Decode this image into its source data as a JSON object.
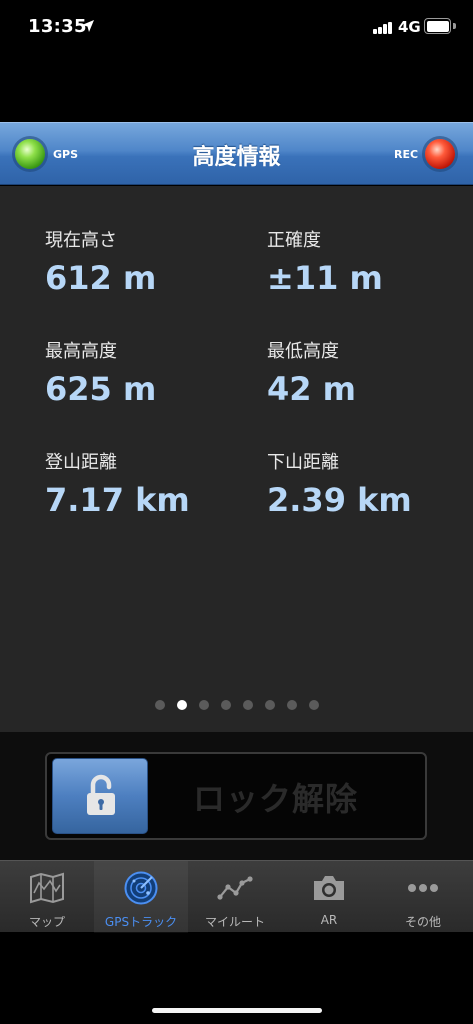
{
  "status_bar": {
    "time": "13:35",
    "network": "4G",
    "icons": [
      "location-arrow-icon",
      "signal-icon",
      "battery-icon"
    ]
  },
  "header": {
    "title": "高度情報",
    "gps_label": "GPS",
    "rec_label": "REC",
    "gps_led_color": "#5ccf2a",
    "rec_led_color": "#e8321d",
    "bar_color": "#4f86c9"
  },
  "info": {
    "current_altitude": {
      "label": "現在高さ",
      "value": "612 m"
    },
    "accuracy": {
      "label": "正確度",
      "value": "±11 m"
    },
    "max_altitude": {
      "label": "最高高度",
      "value": "625 m"
    },
    "min_altitude": {
      "label": "最低高度",
      "value": "42 m"
    },
    "ascent_distance": {
      "label": "登山距離",
      "value": "7.17 km"
    },
    "descent_distance": {
      "label": "下山距離",
      "value": "2.39 km"
    },
    "value_color": "#b7d7f7"
  },
  "pager": {
    "pages": 8,
    "active_page": 2
  },
  "lock": {
    "label": "ロック解除",
    "icon": "padlock-open-icon"
  },
  "tabs": [
    {
      "label": "マップ",
      "icon": "map-icon",
      "active": false
    },
    {
      "label": "GPSトラック",
      "icon": "radar-icon",
      "active": true
    },
    {
      "label": "マイルート",
      "icon": "route-icon",
      "active": false
    },
    {
      "label": "AR",
      "icon": "camera-icon",
      "active": false
    },
    {
      "label": "その他",
      "icon": "more-icon",
      "active": false
    }
  ],
  "accent_color": "#4b8ff2"
}
